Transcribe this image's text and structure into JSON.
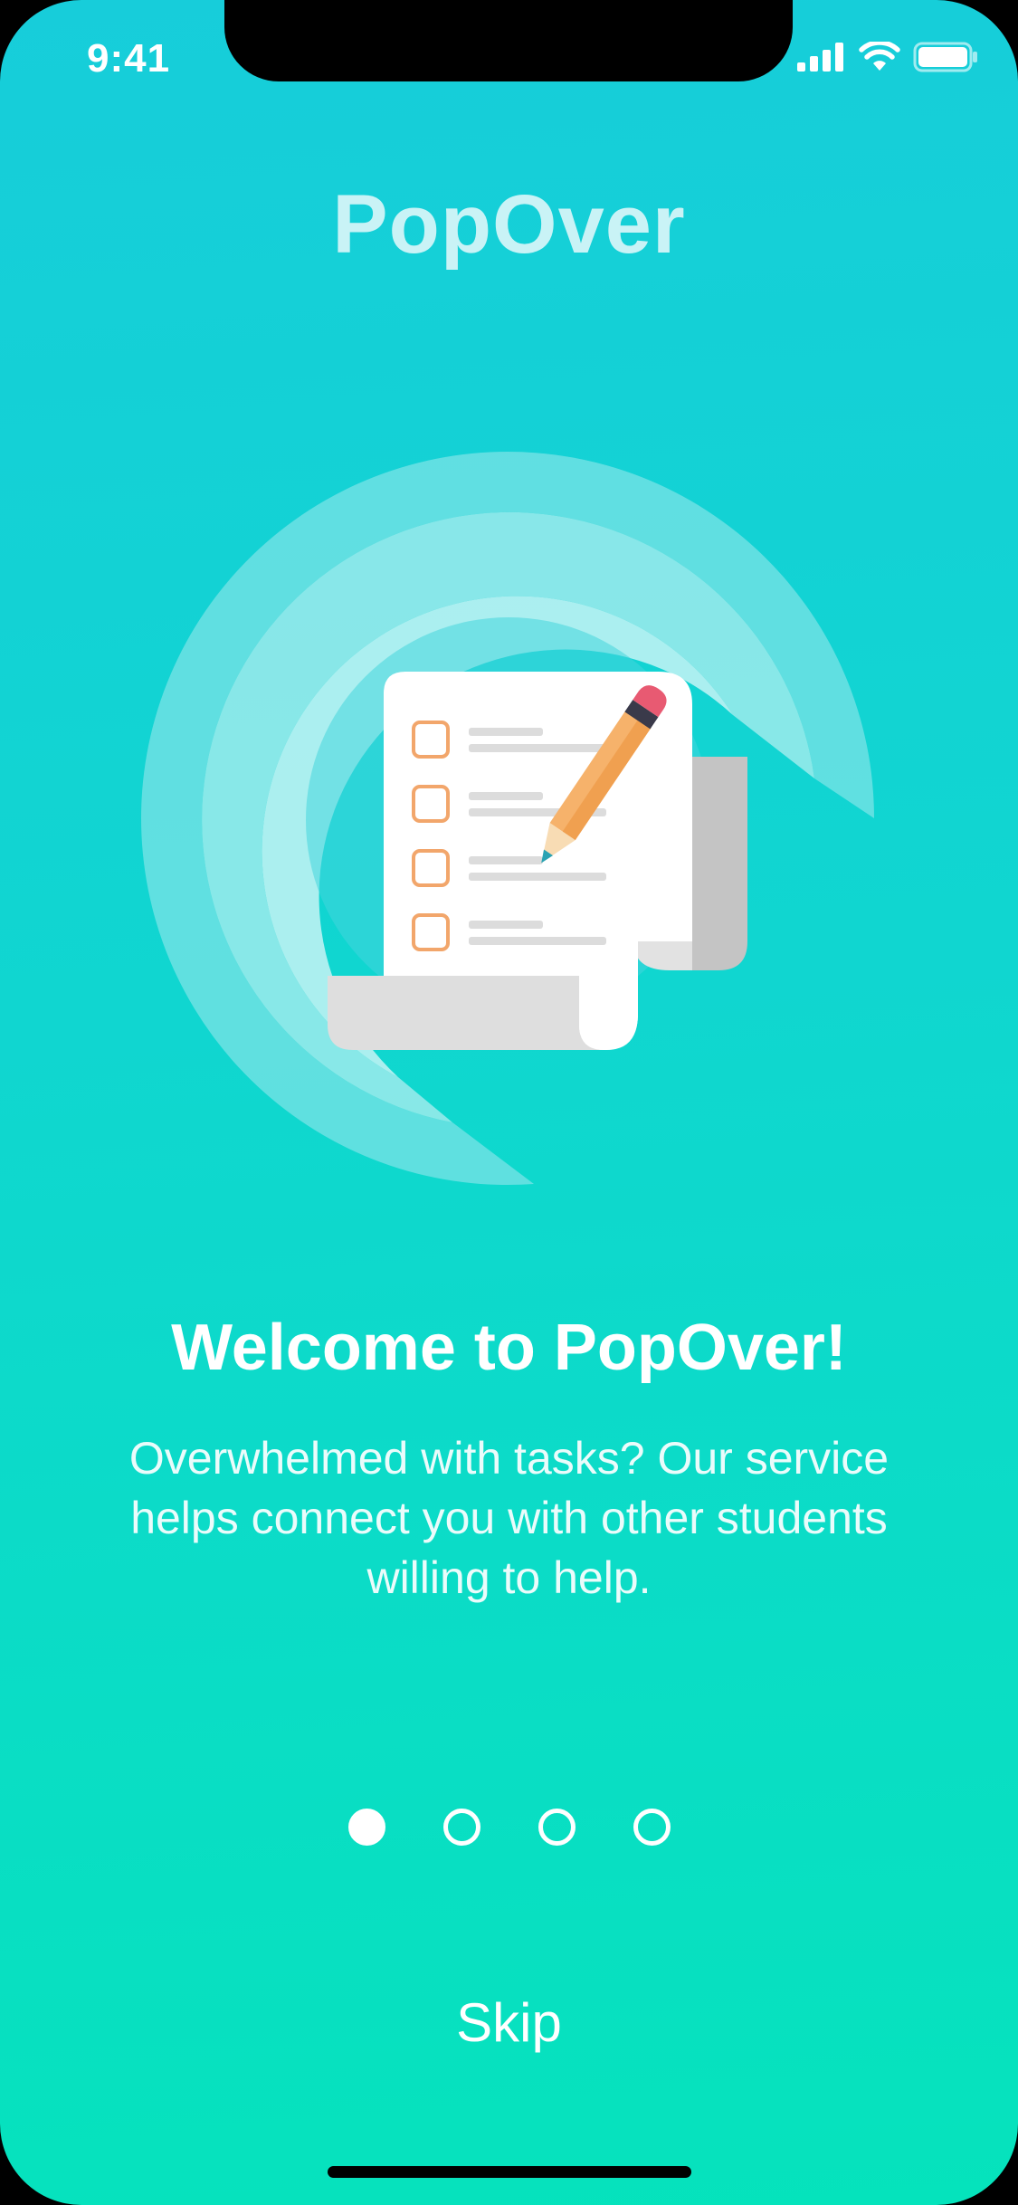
{
  "status_bar": {
    "time": "9:41"
  },
  "app": {
    "title": "PopOver"
  },
  "onboarding": {
    "heading": "Welcome to PopOver!",
    "description": "Overwhelmed with tasks? Our service helps connect you with other students willing to help.",
    "skip_label": "Skip",
    "page_count": 4,
    "current_page": 1
  },
  "colors": {
    "background_top": "#17cdda",
    "background_bottom": "#05e3bc",
    "checkbox_outline": "#f2a66b",
    "pencil_body": "#f6b26b",
    "pencil_eraser": "#e85a72"
  }
}
